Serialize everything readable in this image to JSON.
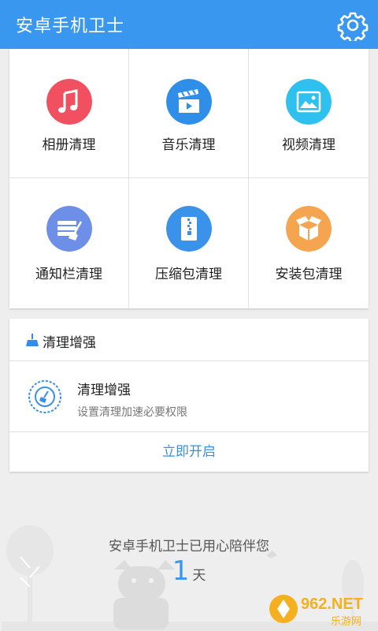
{
  "app": {
    "title": "安卓手机卫士"
  },
  "grid": {
    "items": [
      {
        "label": "相册清理",
        "icon": "music-note-icon",
        "color": "#f05060"
      },
      {
        "label": "音乐清理",
        "icon": "clapperboard-icon",
        "color": "#2f8fe8"
      },
      {
        "label": "视频清理",
        "icon": "image-icon",
        "color": "#2ec0ee"
      },
      {
        "label": "通知栏清理",
        "icon": "notification-broom-icon",
        "color": "#6d8fe8"
      },
      {
        "label": "压缩包清理",
        "icon": "zip-file-icon",
        "color": "#3a93e8"
      },
      {
        "label": "安装包清理",
        "icon": "package-box-icon",
        "color": "#f5a550"
      }
    ]
  },
  "enhance": {
    "header": "清理增强",
    "item_title": "清理增强",
    "item_desc": "设置清理加速必要权限",
    "action": "立即开启"
  },
  "footer": {
    "text": "安卓手机卫士已用心陪伴您",
    "days": "1",
    "unit": "天"
  },
  "watermark": {
    "text": "962.NET",
    "subtext": "乐游网"
  },
  "colors": {
    "primary": "#3a97ef",
    "background": "#eeeeee"
  }
}
